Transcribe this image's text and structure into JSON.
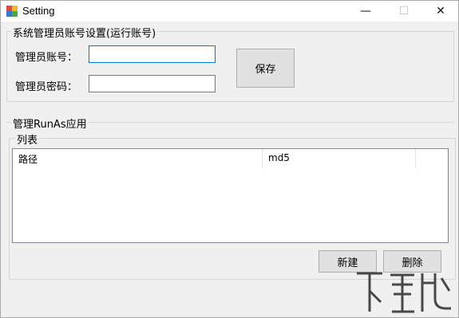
{
  "window": {
    "title": "Setting",
    "controls": {
      "minimize": "—",
      "maximize": "☐",
      "close": "✕"
    }
  },
  "admin_group": {
    "caption": "系统管理员账号设置(运行账号)",
    "account_label": "管理员账号：",
    "account_value": "",
    "password_label": "管理员密码：",
    "password_value": "",
    "save_label": "保存"
  },
  "runas_group": {
    "caption": "管理RunAs应用",
    "list_caption": "列表",
    "columns": [
      "路径",
      "md5"
    ],
    "rows": [],
    "new_label": "新建",
    "delete_label": "删除"
  },
  "colors": {
    "focus_border": "#0078d7",
    "window_bg": "#f0f0f0"
  }
}
